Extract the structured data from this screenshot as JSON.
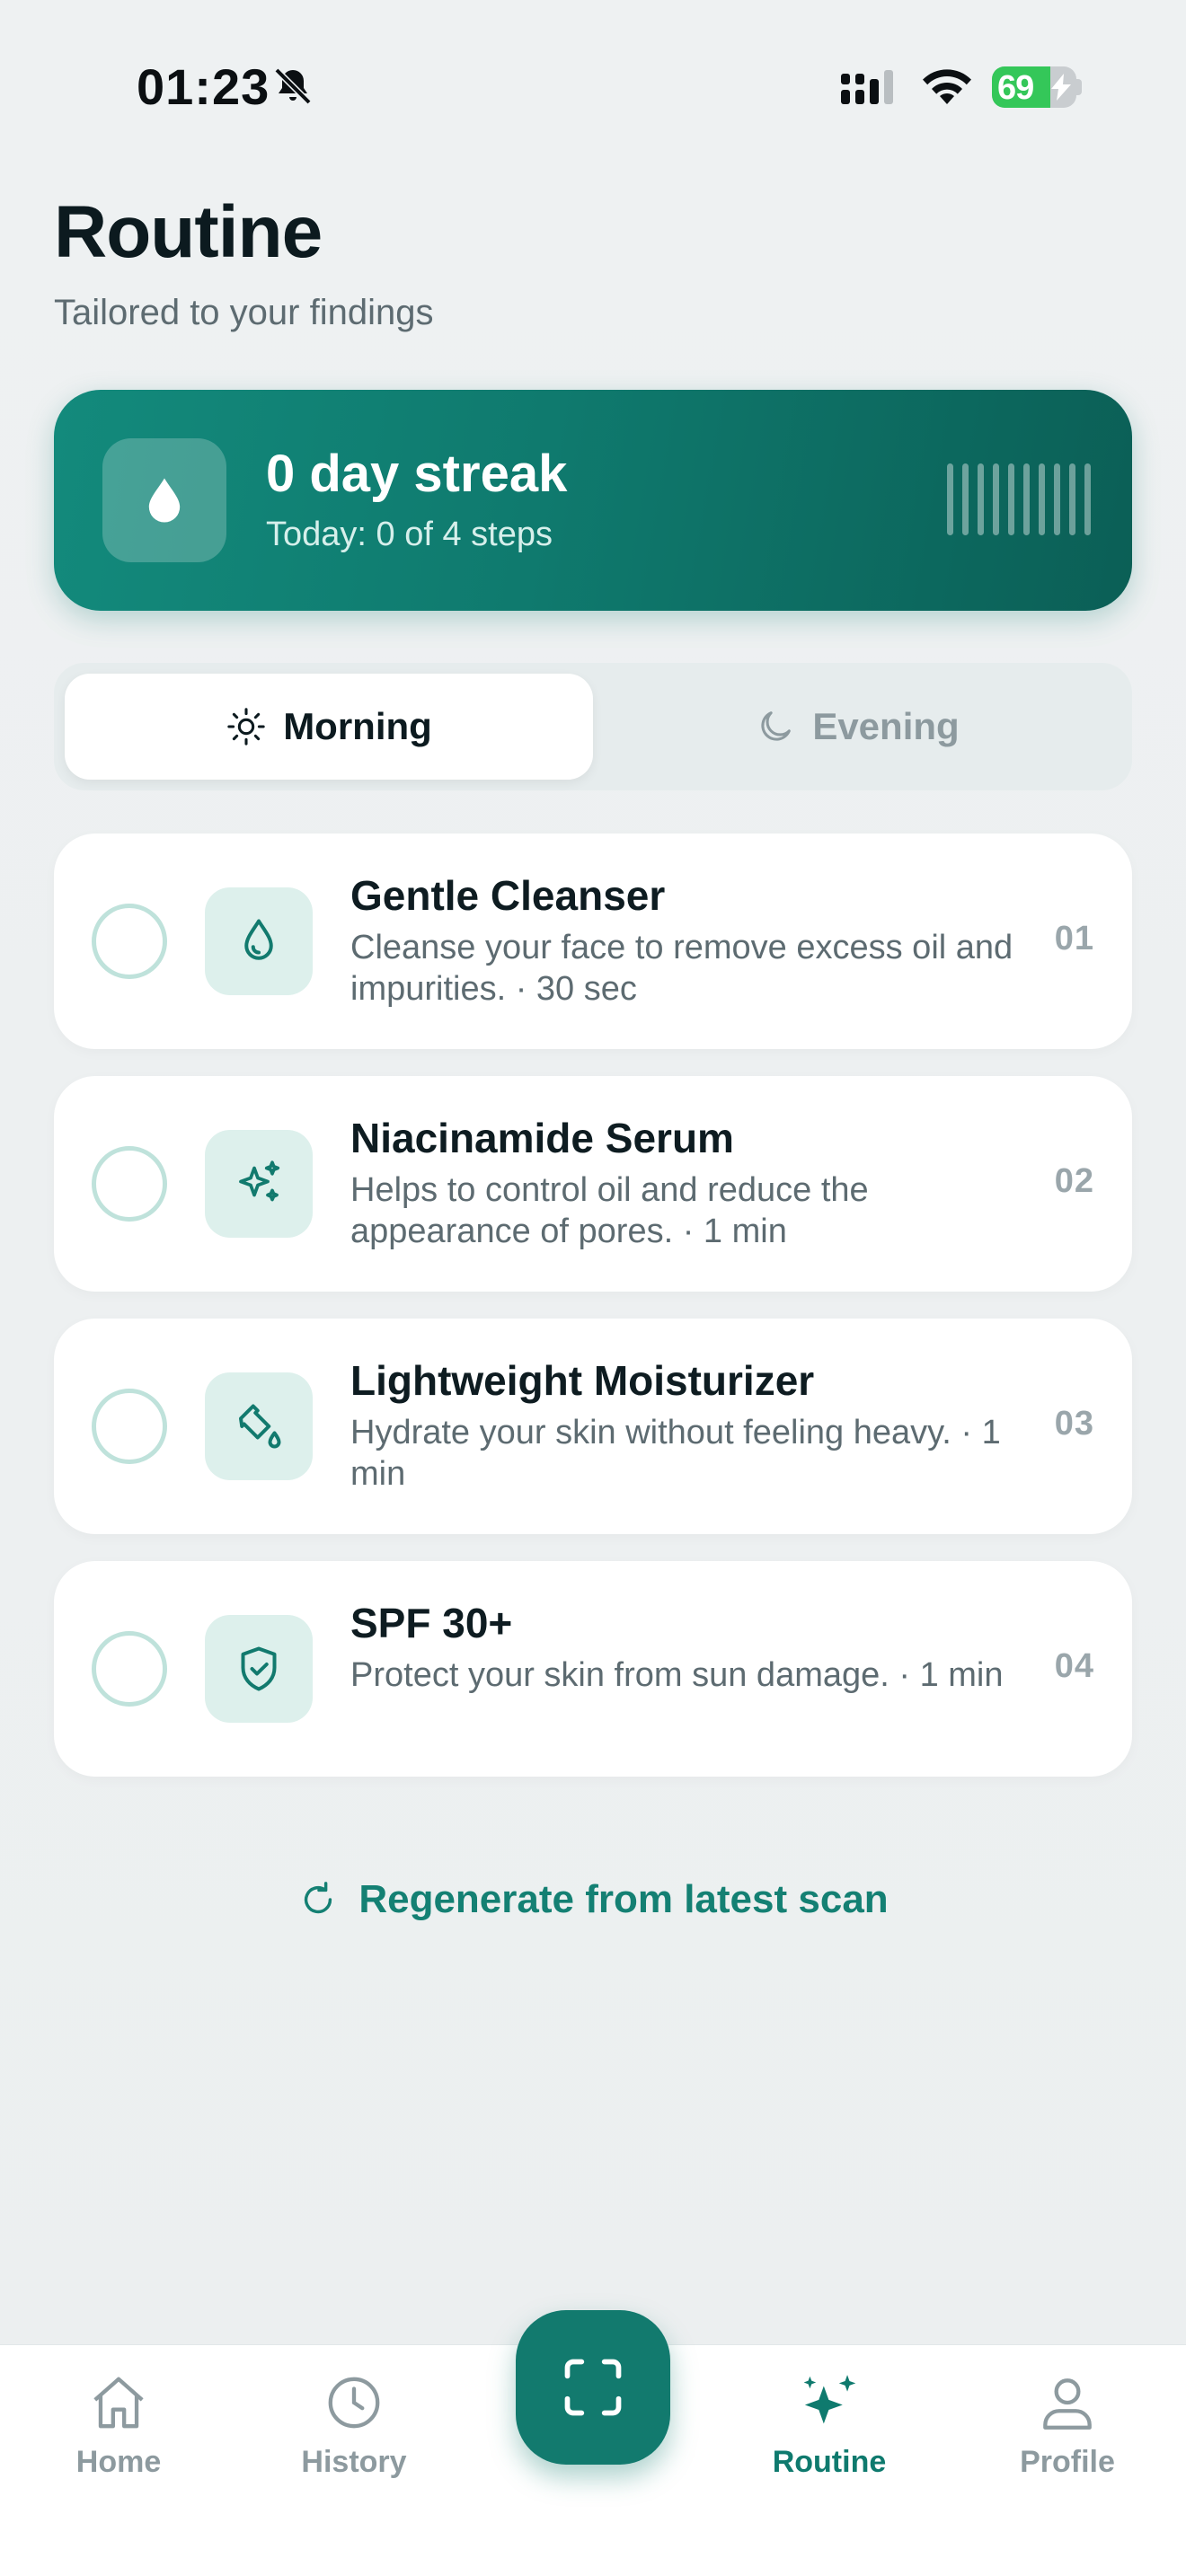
{
  "status_bar": {
    "time": "01:23",
    "battery_percent": "69",
    "battery_level": 0.69,
    "icons": [
      "bell-slash-icon",
      "cellular-signal-icon",
      "wifi-icon",
      "battery-charging-icon"
    ]
  },
  "header": {
    "title": "Routine",
    "subtitle": "Tailored to your findings"
  },
  "streak": {
    "title": "0 day streak",
    "subtitle": "Today: 0 of 4 steps",
    "icon": "droplet-icon",
    "bars": 10
  },
  "segments": [
    {
      "label": "Morning",
      "icon": "sun-icon",
      "selected": true
    },
    {
      "label": "Evening",
      "icon": "moon-icon",
      "selected": false
    }
  ],
  "steps": [
    {
      "title": "Gentle Cleanser",
      "description": "Cleanse your face to remove excess oil and impurities. · 30 sec",
      "number": "01",
      "icon": "droplet-icon",
      "completed": false
    },
    {
      "title": "Niacinamide Serum",
      "description": "Helps to control oil and reduce the appearance of pores. · 1 min",
      "number": "02",
      "icon": "sparkles-icon",
      "completed": false
    },
    {
      "title": "Lightweight Moisturizer",
      "description": "Hydrate your skin without feeling heavy. · 1 min",
      "number": "03",
      "icon": "bottle-icon",
      "completed": false
    },
    {
      "title": "SPF 30+",
      "description": "Protect your skin from sun damage. · 1 min",
      "number": "04",
      "icon": "shield-check-icon",
      "completed": false
    }
  ],
  "regenerate": {
    "label": "Regenerate from latest scan",
    "icon": "refresh-icon"
  },
  "tabs": [
    {
      "label": "Home",
      "icon": "home-icon",
      "active": false
    },
    {
      "label": "History",
      "icon": "clock-icon",
      "active": false
    },
    {
      "label": "Routine",
      "icon": "sparkles-icon",
      "active": true
    },
    {
      "label": "Profile",
      "icon": "person-icon",
      "active": false
    }
  ],
  "scan_button": {
    "icon": "scan-frame-icon"
  },
  "colors": {
    "accent": "#0f7a6e",
    "accent_light": "#ddf0ec",
    "background": "#eef1f2",
    "muted_text": "#5d6b71",
    "battery_green": "#34c759"
  }
}
